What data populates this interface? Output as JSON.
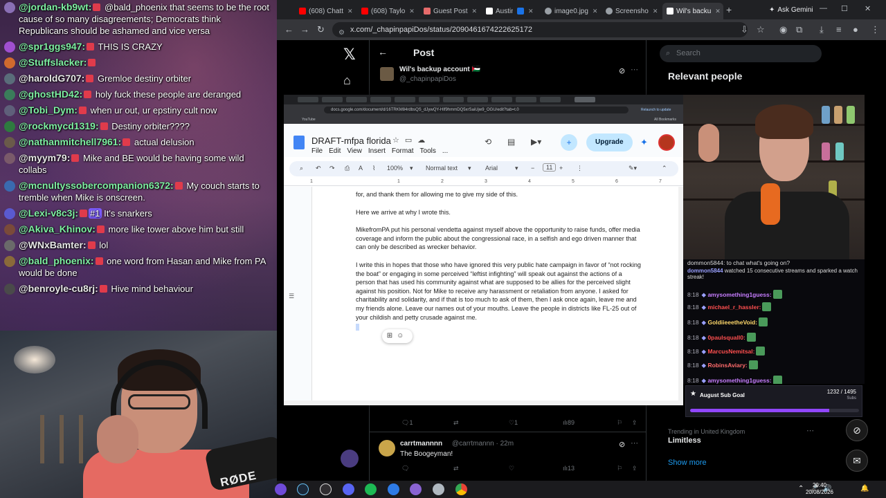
{
  "chat_overlay": {
    "messages": [
      {
        "user": "@jordan-kb9wt:",
        "text": "@bald_phoenix that seems to be the root cause of so many disagreements; Democrats think Republicans should be ashamed and vice versa",
        "color": "#7ef0a2"
      },
      {
        "user": "@spr1ggs947:",
        "text": "THIS IS CRAZY",
        "color": "#7ef0a2"
      },
      {
        "user": "@Stuffslacker:",
        "text": "",
        "color": "#7ef0a2"
      },
      {
        "user": "@haroldG707:",
        "text": "Gremloe destiny orbiter",
        "color": "#e8e8e8"
      },
      {
        "user": "@ghostHD42:",
        "text": "holy fuck these people are deranged",
        "color": "#7ef0a2"
      },
      {
        "user": "@Tobi_Dym:",
        "text": "when ur out, ur epstiny cult now",
        "color": "#7ef0a2"
      },
      {
        "user": "@rockmycd1319:",
        "text": "Destiny orbiter????",
        "color": "#7ef0a2"
      },
      {
        "user": "@nathanmitchell7961:",
        "text": "actual delusion",
        "color": "#7ef0a2"
      },
      {
        "user": "@myym79:",
        "text": "Mike and BE would be having some wild collabs",
        "color": "#e8e8e8"
      },
      {
        "user": "@mcnultyssobercompanion6372:",
        "text": "My couch starts to tremble when Mike is onscreen.",
        "color": "#7ef0a2"
      },
      {
        "user": "@Lexi-v8c3j:",
        "text": "It's snarkers",
        "color": "#7ef0a2",
        "badge_text": "#1"
      },
      {
        "user": "@Akiva_Khinov:",
        "text": "more like tower above him but still",
        "color": "#7ef0a2"
      },
      {
        "user": "@WNxBamter:",
        "text": "lol",
        "color": "#e8e8e8"
      },
      {
        "user": "@bald_phoenix:",
        "text": "one word from Hasan and Mike from PA would be done",
        "color": "#7ef0a2"
      },
      {
        "user": "@benroyle-cu8rj:",
        "text": "Hive mind behaviour",
        "color": "#e8e8e8"
      }
    ]
  },
  "webcam_left": {
    "mic_brand": "RØDE"
  },
  "browser": {
    "tabs": [
      {
        "label": "(608) Chatt",
        "fav_color": "#ff0000"
      },
      {
        "label": "(608) Taylo",
        "fav_color": "#ff0000"
      },
      {
        "label": "Guest Post",
        "fav_color": "#e66b6b"
      },
      {
        "label": "Austin",
        "fav_color": "#ffffff"
      },
      {
        "label": "",
        "fav_color": "#1a73e8"
      },
      {
        "label": "image0.jpg",
        "fav_color": "#9aa0a6"
      },
      {
        "label": "Screensho",
        "fav_color": "#9aa0a6"
      },
      {
        "label": "Wil's backu",
        "fav_color": "#ffffff"
      }
    ],
    "gemini_label": "Ask Gemini",
    "url": "x.com/_chapinpapiDos/status/2090461674222625172"
  },
  "xpage": {
    "post_header": "Post",
    "author_name": "Wil's backup account 🇵🇸",
    "author_handle": "@_chapinpapiDos",
    "search_placeholder": "Search",
    "relevant_title": "Relevant people",
    "actions_main": {
      "replies": "1",
      "retweets": "",
      "likes": "1",
      "views": "89"
    },
    "reply": {
      "name": "carrtmannnn",
      "handle": "@carrtmannn · 22m",
      "text": "The Boogeyman!"
    },
    "actions_reply": {
      "views": "13"
    },
    "trend_meta": "Trending in United Kingdom",
    "trend_name": "Limitless",
    "show_more": "Show more"
  },
  "docs": {
    "url": "docs.google.com/document/d/16TRKM84rdbsQS_dJywQY-HIf9hmmDQ5xrSaiUjw9_OGU/edit?tab=t.0",
    "relaunch": "Relaunch to update",
    "bookmark": "YouTube",
    "all_bookmarks": "All Bookmarks",
    "title": "DRAFT-mfpa florida",
    "menu": [
      "File",
      "Edit",
      "View",
      "Insert",
      "Format",
      "Tools",
      "..."
    ],
    "upgrade": "Upgrade",
    "zoom": "100%",
    "style": "Normal text",
    "font": "Arial",
    "font_size": "11",
    "ruler": [
      "1",
      "1",
      "2",
      "3",
      "4",
      "5",
      "6",
      "7"
    ],
    "paragraphs": [
      "for, and thank them for allowing me to give my side of this.",
      "Here we arrive at why I wrote this.",
      "MikefromPA put his personal vendetta against myself above the opportunity to raise funds, offer media coverage and inform the public about the congressional race, in a selfish and ego driven manner that can only be described as wrecker behavior.",
      "I write this in hopes that those who have ignored this very public hate campaign in favor of “not rocking the boat” or engaging in some perceived “leftist infighting” will speak out against the actions of a person that has used his community against what are supposed to be allies for the perceived slight against his position. Not for Mike to receive any harassment or retaliation from anyone. I asked for charitability and solidarity, and if that is too much to ask of them, then I ask once again, leave me and my friends alone. Leave our names out of your mouths. Leave the people in districts like FL-25 out of your childish and petty crusade against me."
    ]
  },
  "twitch_chat": {
    "lines": [
      {
        "time": "",
        "name": "",
        "text": "dommon5844: to chat what's going on?",
        "color": "#9aa0ff"
      },
      {
        "time": "",
        "name": "dommon5844",
        "text": "watched 15 consecutive streams and sparked a watch streak!",
        "color": "#9aa0ff"
      },
      {
        "time": "8:18",
        "name": "amysomething1guess:",
        "text": "",
        "color": "#c77dff"
      },
      {
        "time": "8:18",
        "name": "michael_r_hassler:",
        "text": "",
        "color": "#ff4f4f"
      },
      {
        "time": "8:18",
        "name": "GoldiieeetheVoid:",
        "text": "",
        "color": "#ffd86b"
      },
      {
        "time": "8:18",
        "name": "0paulsquall0:",
        "text": "",
        "color": "#ff4f4f"
      },
      {
        "time": "8:18",
        "name": "MarcusNemitsal:",
        "text": "",
        "color": "#ff4f4f"
      },
      {
        "time": "8:18",
        "name": "RobinsAviary:",
        "text": "",
        "color": "#ff6b6b"
      },
      {
        "time": "8:18",
        "name": "amysomething1guess:",
        "text": "",
        "color": "#c77dff"
      }
    ]
  },
  "sub_goal": {
    "label": "August Sub Goal",
    "count": "1232 / 1495",
    "unit": "Subs",
    "progress": 0.824,
    "color": "#9146ff"
  },
  "taskbar": {
    "time": "20:40",
    "date": "20/08/2026"
  }
}
